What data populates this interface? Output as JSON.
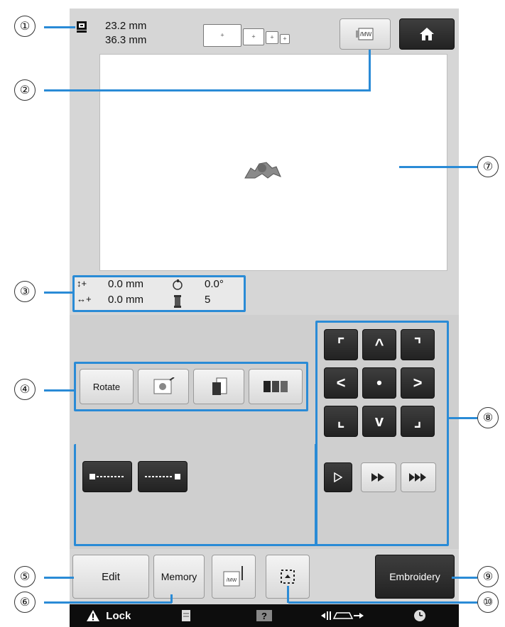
{
  "size_readout": {
    "height": "23.2 mm",
    "width": "36.3 mm"
  },
  "info": {
    "vertical_offset": "0.0 mm",
    "horizontal_offset": "0.0 mm",
    "rotation": "0.0°",
    "thread_count": "5",
    "vertical_symbol": "↕+",
    "horizontal_symbol": "↔+"
  },
  "edit_buttons": {
    "rotate_label": "Rotate"
  },
  "bottom_buttons": {
    "edit_label": "Edit",
    "memory_label": "Memory",
    "embroidery_label": "Embroidery"
  },
  "status_bar": {
    "lock_label": "Lock"
  },
  "move_pad": {
    "up_left": "⌜",
    "up": "^",
    "up_right": "⌝",
    "left": "<",
    "center": "•",
    "right": ">",
    "down_left": "⌞",
    "down": "v",
    "down_right": "⌟"
  },
  "callouts": [
    "①",
    "②",
    "③",
    "④",
    "⑤",
    "⑥",
    "⑦",
    "⑧",
    "⑨",
    "⑩"
  ],
  "colors": {
    "callout_blue": "#2a8bd6",
    "screen_bg": "#d6d6d6",
    "dark_button": "#2a2a2a"
  }
}
